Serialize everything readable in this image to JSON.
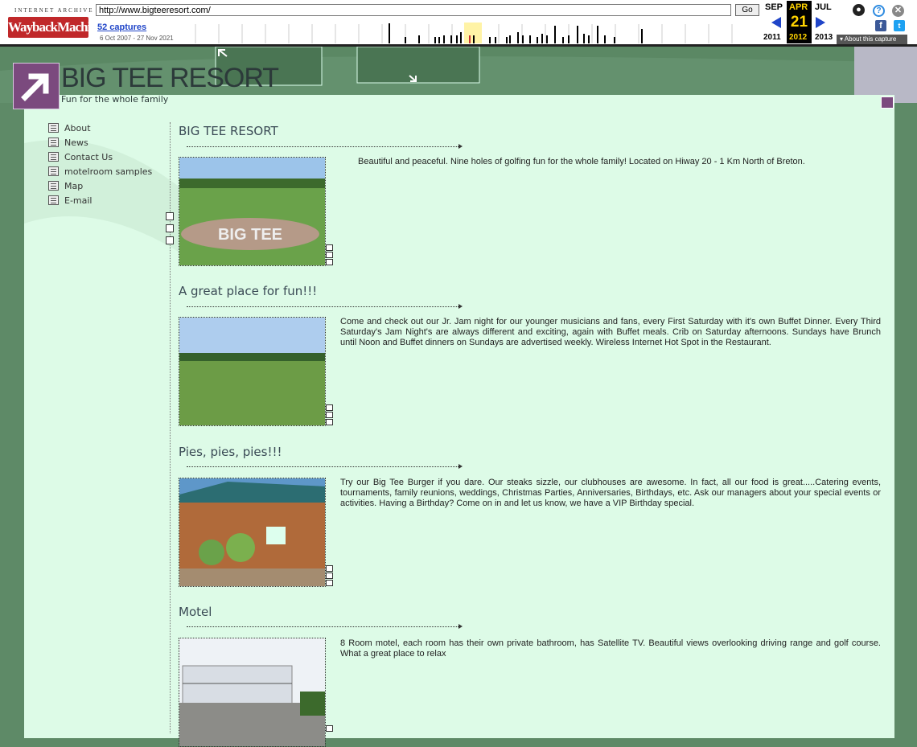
{
  "wayback": {
    "logo_top": "INTERNET ARCHIVE",
    "logo_main": "WaybackMachine",
    "url": "http://www.bigteeresort.com/",
    "go_label": "Go",
    "captures": "52 captures",
    "range": "6 Oct 2007 - 27 Nov 2021",
    "prev_month": "SEP",
    "cur_month": "APR",
    "next_month": "JUL",
    "day": "21",
    "prev_year": "2011",
    "cur_year": "2012",
    "next_year": "2013",
    "about": "About this capture",
    "accent": "#ffd300"
  },
  "site": {
    "title": "BIG TEE RESORT",
    "tagline": "Fun for the whole family",
    "background": "#5e8a67",
    "panel_color": "#ddfbe7",
    "brand_purple": "#7b4a7e"
  },
  "nav": {
    "items": [
      {
        "label": "About"
      },
      {
        "label": "News"
      },
      {
        "label": "Contact Us"
      },
      {
        "label": "motelroom samples"
      },
      {
        "label": "Map"
      },
      {
        "label": "E-mail"
      }
    ]
  },
  "sections": [
    {
      "title": "BIG TEE RESORT",
      "text": "Beautiful and peaceful. Nine holes of golfing fun for the whole family! Located on Hiway 20 - 1 Km North of Breton.",
      "photo": "golf-course-sign-photo"
    },
    {
      "title": "A great place for fun!!!",
      "text": "Come and check out our Jr. Jam night for our younger musicians and fans, every First Saturday with it's own Buffet Dinner. Every Third Saturday's Jam Night's are always different and exciting, again with Buffet meals. Crib on Saturday afternoons. Sundays have Brunch until Noon and Buffet dinners on Sundays are advertised weekly. Wireless Internet Hot Spot in the Restaurant.",
      "photo": "driving-range-photo"
    },
    {
      "title": "Pies, pies, pies!!!",
      "text": "Try our Big Tee Burger if you dare. Our steaks sizzle, our clubhouses are awesome. In fact, all our food is great.....Catering events, tournaments, family reunions, weddings, Christmas Parties, Anniversaries, Birthdays, etc. Ask our managers about your special events or activities. Having a Birthday? Come on in and let us know, we have a VIP Birthday special.",
      "photo": "clubhouse-photo"
    },
    {
      "title": "Motel",
      "text": "8 Room motel, each room has their own private bathroom, has Satellite TV. Beautiful views overlooking driving range and golf course. What a great place to relax",
      "photo": "motel-photo"
    }
  ]
}
